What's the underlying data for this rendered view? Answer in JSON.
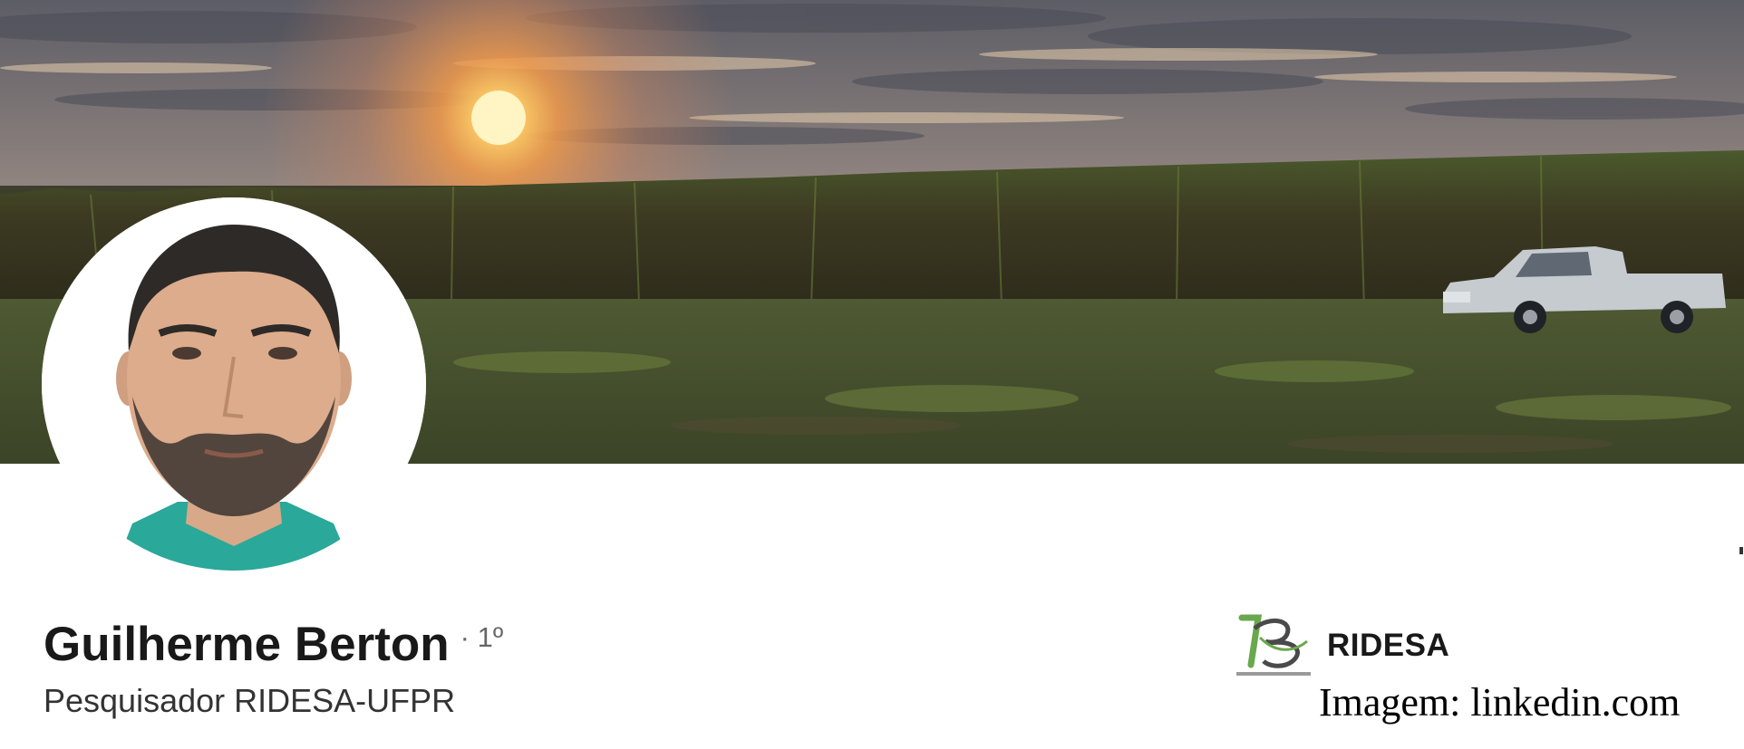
{
  "profile": {
    "name": "Guilherme Berton",
    "connection_degree": "· 1º",
    "headline": "Pesquisador RIDESA-UFPR"
  },
  "experience": {
    "company_name": "RIDESA",
    "logo_icon": "ridesa-logo-icon"
  },
  "credit": {
    "text": "Imagem: linkedin.com"
  },
  "banner": {
    "scene": "cover-photo"
  },
  "colors": {
    "background": "#ffffff",
    "text_primary": "#1f1f1f",
    "text_secondary": "#5e5e5e",
    "logo_green": "#6aa84f"
  }
}
